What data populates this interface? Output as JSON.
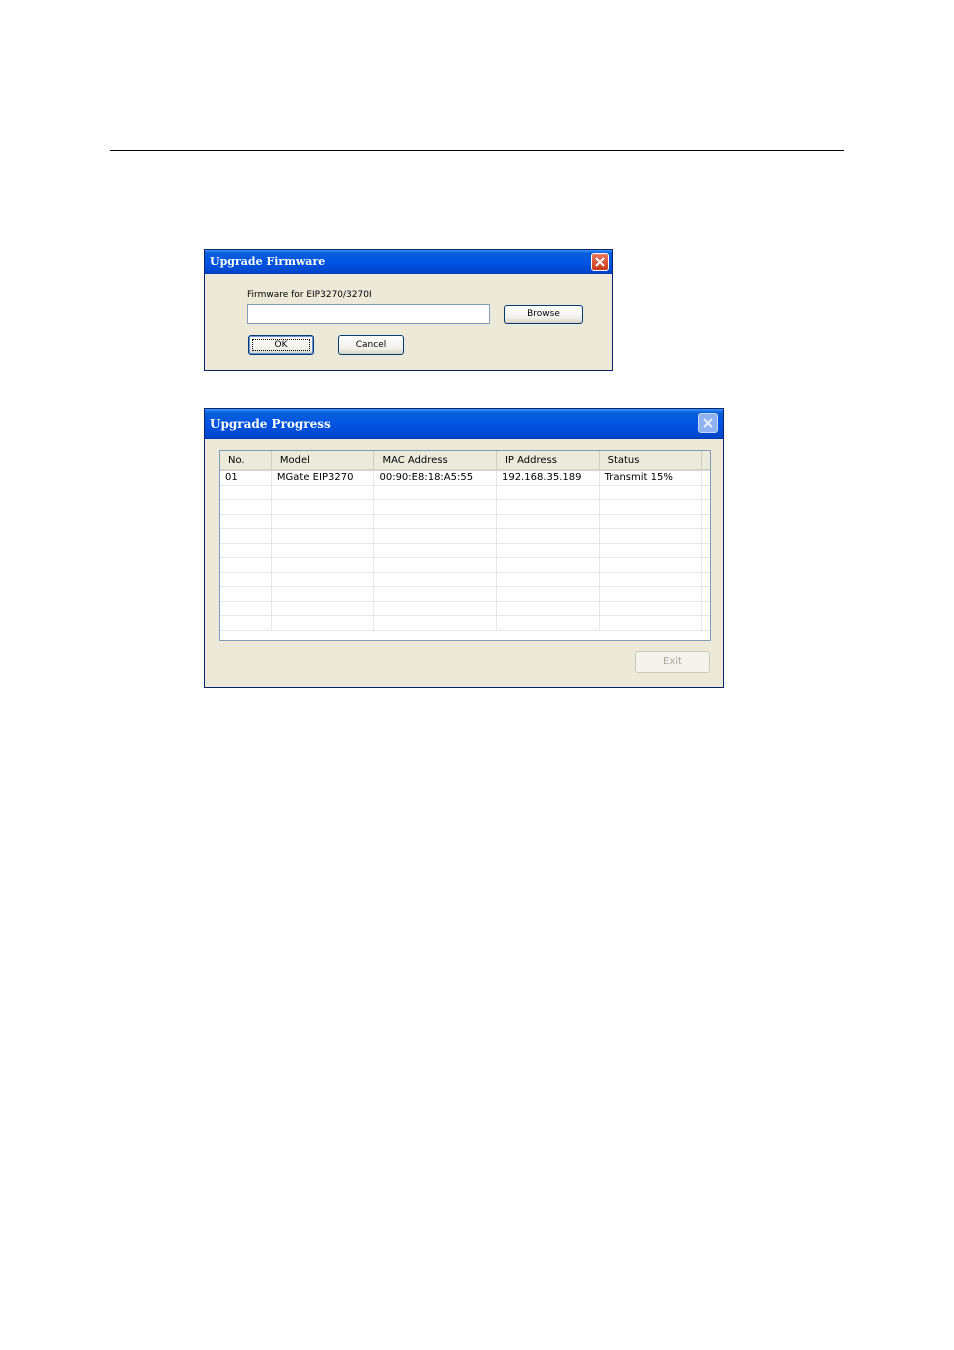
{
  "upgrade_firmware": {
    "title": "Upgrade Firmware",
    "field_label": "Firmware for EIP3270/3270I",
    "field_value": "",
    "browse_label": "Browse",
    "ok_label": "OK",
    "cancel_label": "Cancel"
  },
  "upgrade_progress": {
    "title": "Upgrade Progress",
    "columns": [
      "No.",
      "Model",
      "MAC Address",
      "IP Address",
      "Status"
    ],
    "rows": [
      [
        "01",
        "MGate EIP3270",
        "00:90:E8:18:A5:55",
        "192.168.35.189",
        "Transmit 15%"
      ]
    ],
    "exit_label": "Exit"
  }
}
